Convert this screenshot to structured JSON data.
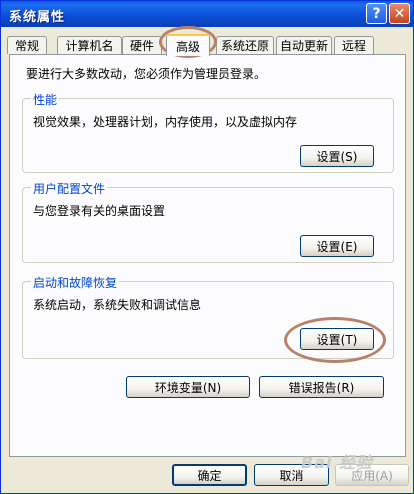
{
  "window": {
    "title": "系统属性"
  },
  "titlebar_buttons": {
    "help": "?",
    "close": "✕"
  },
  "tabs": [
    {
      "label": "常规"
    },
    {
      "label": "计算机名"
    },
    {
      "label": "硬件"
    },
    {
      "label": "高级"
    },
    {
      "label": "系统还原"
    },
    {
      "label": "自动更新"
    },
    {
      "label": "远程"
    }
  ],
  "notice": "要进行大多数改动，您必须作为管理员登录。",
  "groups": {
    "performance": {
      "title": "性能",
      "desc": "视觉效果，处理器计划，内存使用，以及虚拟内存",
      "button": "设置(S)"
    },
    "user_profiles": {
      "title": "用户配置文件",
      "desc": "与您登录有关的桌面设置",
      "button": "设置(E)"
    },
    "startup_recovery": {
      "title": "启动和故障恢复",
      "desc": "系统启动，系统失败和调试信息",
      "button": "设置(T)"
    }
  },
  "actions": {
    "env_vars": "环境变量(N)",
    "error_report": "错误报告(R)"
  },
  "footer": {
    "ok": "确定",
    "cancel": "取消",
    "apply": "应用(A)"
  },
  "watermark": "Bai 经验"
}
